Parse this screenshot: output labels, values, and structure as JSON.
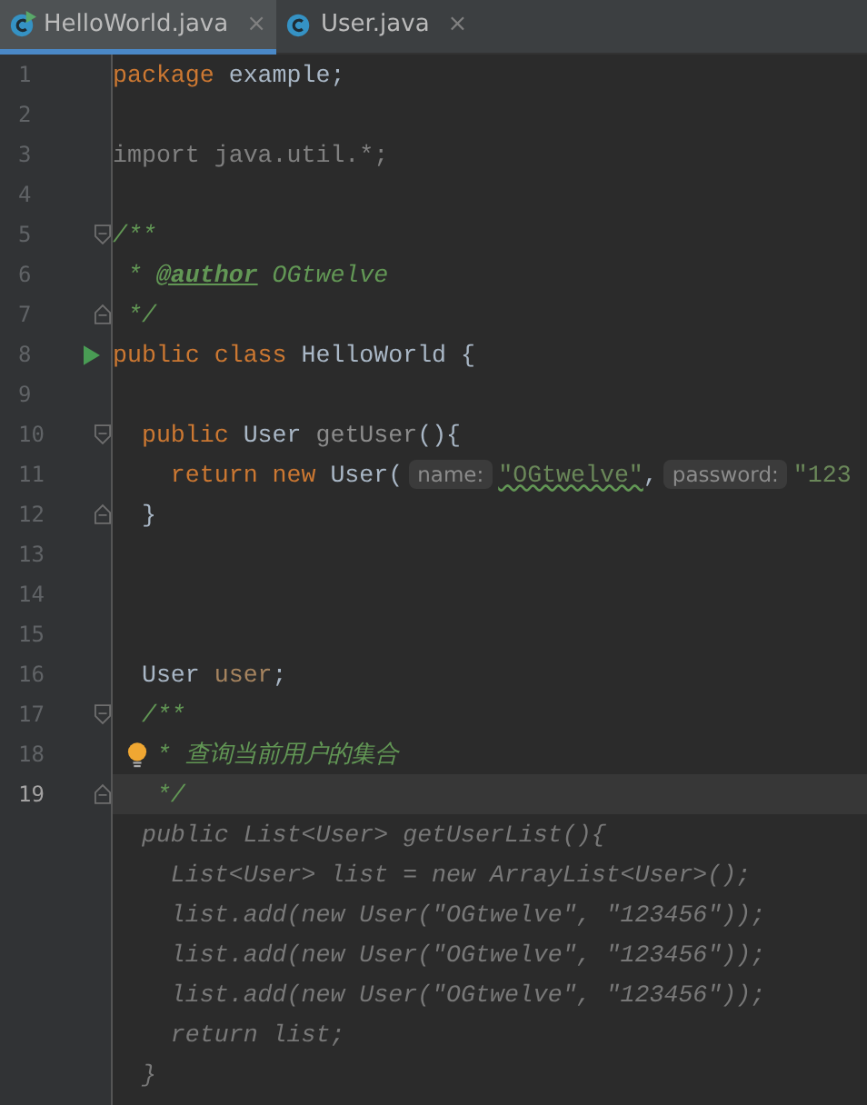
{
  "tabs": [
    {
      "label": "HelloWorld.java",
      "selected": true,
      "runnable": true,
      "close": "×"
    },
    {
      "label": "User.java",
      "selected": false,
      "runnable": false,
      "close": "×"
    }
  ],
  "editor": {
    "lines": [
      {
        "number": "1",
        "current": false,
        "kind": "plain",
        "tokens": [
          {
            "kind": "keyword",
            "text": "package "
          },
          {
            "kind": "plain",
            "text": "example;"
          }
        ]
      },
      {
        "number": "2",
        "current": false,
        "kind": "plain"
      },
      {
        "number": "3",
        "current": false,
        "kind": "plain",
        "tokens": [
          {
            "kind": "unused",
            "text": "import java.util.*;"
          }
        ]
      },
      {
        "number": "4",
        "current": false,
        "kind": "plain"
      },
      {
        "number": "5",
        "current": false,
        "kind": "fold-start",
        "tokens": [
          {
            "kind": "comment",
            "text": "/**"
          }
        ]
      },
      {
        "number": "6",
        "current": false,
        "kind": "plain",
        "tokens": [
          {
            "kind": "comment",
            "text": " * "
          },
          {
            "kind": "doctag",
            "text": "@author"
          },
          {
            "kind": "comment",
            "text": " OGtwelve"
          }
        ]
      },
      {
        "number": "7",
        "current": false,
        "kind": "fold-end",
        "tokens": [
          {
            "kind": "comment",
            "text": " */"
          }
        ]
      },
      {
        "number": "8",
        "current": false,
        "kind": "run",
        "tokens": [
          {
            "kind": "keyword",
            "text": "public class "
          },
          {
            "kind": "plain",
            "text": "HelloWorld {"
          }
        ]
      },
      {
        "number": "9",
        "current": false,
        "kind": "plain"
      },
      {
        "number": "10",
        "current": false,
        "kind": "fold-start",
        "tokens": [
          {
            "kind": "keyword",
            "text": "  public "
          },
          {
            "kind": "plain",
            "text": "User "
          },
          {
            "kind": "unusedmethod",
            "text": "getUser"
          },
          {
            "kind": "plain",
            "text": "(){"
          }
        ]
      },
      {
        "number": "11",
        "current": false,
        "kind": "plain",
        "tokens": [
          {
            "kind": "keyword",
            "text": "    return new "
          },
          {
            "kind": "plain",
            "text": "User("
          },
          {
            "kind": "hint",
            "text": "name:"
          },
          {
            "kind": "typo",
            "text": "\"OGtwelve\""
          },
          {
            "kind": "plain",
            "text": ","
          },
          {
            "kind": "hint",
            "text": "password:"
          },
          {
            "kind": "string",
            "text": "\"123"
          }
        ]
      },
      {
        "number": "12",
        "current": false,
        "kind": "fold-end",
        "tokens": [
          {
            "kind": "plain",
            "text": "  }"
          }
        ]
      },
      {
        "number": "13",
        "current": false,
        "kind": "plain"
      },
      {
        "number": "14",
        "current": false,
        "kind": "plain"
      },
      {
        "number": "15",
        "current": false,
        "kind": "plain"
      },
      {
        "number": "16",
        "current": false,
        "kind": "plain",
        "tokens": [
          {
            "kind": "plain",
            "text": "  User "
          },
          {
            "kind": "unusedvar",
            "text": "user"
          },
          {
            "kind": "plain",
            "text": ";"
          }
        ]
      },
      {
        "number": "17",
        "current": false,
        "kind": "fold-start",
        "tokens": [
          {
            "kind": "comment",
            "text": "  /**"
          }
        ]
      },
      {
        "number": "18",
        "current": false,
        "kind": "bulb",
        "tokens": [
          {
            "kind": "comment",
            "text": "* 查询当前用户的集合"
          }
        ]
      },
      {
        "number": "19",
        "current": true,
        "kind": "fold-end",
        "tokens": [
          {
            "kind": "comment",
            "text": "   */"
          }
        ]
      },
      {
        "current": false,
        "kind": "plain",
        "tokens": [
          {
            "kind": "dim",
            "text": "  public List<User> getUserList(){"
          }
        ]
      },
      {
        "current": false,
        "kind": "plain",
        "tokens": [
          {
            "kind": "dim",
            "text": "    List<User> list = new ArrayList<User>();"
          }
        ]
      },
      {
        "current": false,
        "kind": "plain",
        "tokens": [
          {
            "kind": "dim",
            "text": "    list.add(new User(\"OGtwelve\", \"123456\"));"
          }
        ]
      },
      {
        "current": false,
        "kind": "plain",
        "tokens": [
          {
            "kind": "dim",
            "text": "    list.add(new User(\"OGtwelve\", \"123456\"));"
          }
        ]
      },
      {
        "current": false,
        "kind": "plain",
        "tokens": [
          {
            "kind": "dim",
            "text": "    list.add(new User(\"OGtwelve\", \"123456\"));"
          }
        ]
      },
      {
        "current": false,
        "kind": "plain",
        "tokens": [
          {
            "kind": "dim",
            "text": "    return list;"
          }
        ]
      },
      {
        "current": false,
        "kind": "plain",
        "tokens": [
          {
            "kind": "dim",
            "text": "  }"
          }
        ]
      }
    ]
  }
}
